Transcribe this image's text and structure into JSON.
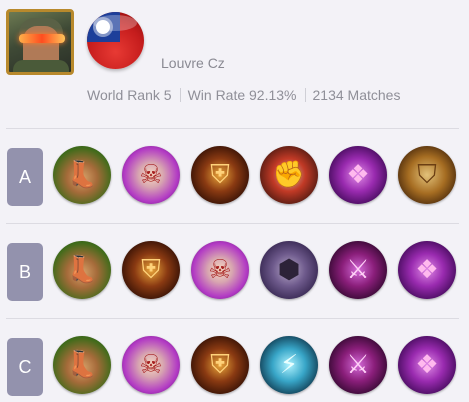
{
  "profile": {
    "player_name": "Louvre Cz",
    "avatar_icon": "hero-portrait-icon",
    "flag_icon": "taiwan-flag-icon"
  },
  "stats": {
    "world_rank": "World Rank 5",
    "win_rate": "Win Rate 92.13%",
    "matches": "2134 Matches"
  },
  "builds": [
    {
      "label": "A",
      "items": [
        {
          "icon": "boots-icon",
          "style": "boots",
          "glyph": "👢"
        },
        {
          "icon": "skull-mask-icon",
          "style": "skull",
          "glyph": "☠"
        },
        {
          "icon": "dark-armor-icon",
          "style": "armor",
          "glyph": "⛨"
        },
        {
          "icon": "gauntlet-icon",
          "style": "gauntlet",
          "glyph": "✊"
        },
        {
          "icon": "purple-crest-icon",
          "style": "crest",
          "glyph": "❖"
        },
        {
          "icon": "golden-shield-icon",
          "style": "shield",
          "glyph": "⛉"
        }
      ]
    },
    {
      "label": "B",
      "items": [
        {
          "icon": "boots-icon",
          "style": "boots",
          "glyph": "👢"
        },
        {
          "icon": "dark-armor-icon",
          "style": "armor",
          "glyph": "⛨"
        },
        {
          "icon": "skull-mask-icon",
          "style": "skull",
          "glyph": "☠"
        },
        {
          "icon": "chest-plate-icon",
          "style": "plate",
          "glyph": "⬢"
        },
        {
          "icon": "cleaver-blade-icon",
          "style": "cleaver",
          "glyph": "⚔"
        },
        {
          "icon": "purple-crest-icon",
          "style": "crest",
          "glyph": "❖"
        }
      ]
    },
    {
      "label": "C",
      "items": [
        {
          "icon": "boots-icon",
          "style": "boots",
          "glyph": "👢"
        },
        {
          "icon": "skull-mask-icon",
          "style": "skull",
          "glyph": "☠"
        },
        {
          "icon": "dark-armor-icon",
          "style": "armor",
          "glyph": "⛨"
        },
        {
          "icon": "ice-trident-icon",
          "style": "trident",
          "glyph": "⚡"
        },
        {
          "icon": "cleaver-blade-icon",
          "style": "cleaver",
          "glyph": "⚔"
        },
        {
          "icon": "purple-crest-icon",
          "style": "crest",
          "glyph": "❖"
        }
      ]
    }
  ],
  "colors": {
    "background": "#f3f2f7",
    "label_badge": "#9392ad",
    "muted_text": "#8f8f98"
  }
}
